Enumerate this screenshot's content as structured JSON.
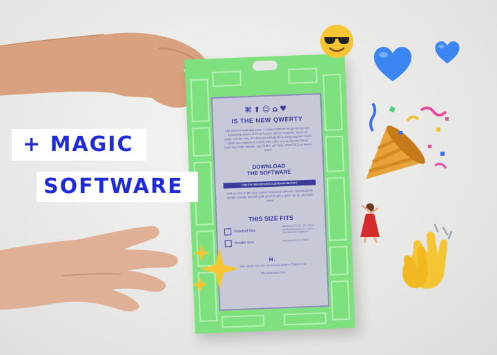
{
  "caption": {
    "line1": "+ MAGIC",
    "line2": "SOFTWARE"
  },
  "package": {
    "logo_glyphs": "⌘⬆☺⌂♥",
    "headline": "IS THE NEW QWERTY",
    "intro_copy": "Our silicone keyboard cover + magic software brings the joy and expressive power of Emoji to your laptop computer. Serve as usual, surf the web, do what you usually do & simply tap the CAPS LOCK key anytime to unlock over 150+ of your favorite Emoji. Each key holds secrets; use SHIFT, OPTION, CONTROL to reveal them!",
    "download_heading_1": "DOWNLOAD",
    "download_heading_2": "THE SOFTWARE",
    "download_url": "http://emojikeyboard.club/download.html",
    "download_copy": "Visit our site to get your custom keyboard software. Download the simple installer that will walk you through a quick set up, and type away!",
    "size_heading": "THIS SIZE FITS",
    "sizes": [
      {
        "label": "Standard Mac",
        "detail": "MacBook Pro 13\", 15\", 2012+ and MacBook Air 13\", 2010+ and Wireless Keyboard"
      },
      {
        "label": "Smaller Size",
        "detail": "MacBook Air 11\", 2010+"
      }
    ],
    "bottom_logo": "H↓",
    "bottom_note": "\"disk cactus\" is an art + technology studio in Oakland, CA",
    "bottom_url": "http://diskcactus.com"
  },
  "emojis": {
    "sunglasses": "😎",
    "heart_large": "💙",
    "heart_small": "💙",
    "party_popper": "🎉",
    "dancer": "💃",
    "sparkles": "✨",
    "clapping": "👏"
  },
  "colors": {
    "caption_text": "#1d2bd8",
    "package_green": "#7fe07f",
    "card_bg": "#c8c9d8",
    "card_text": "#3a3a9a"
  }
}
